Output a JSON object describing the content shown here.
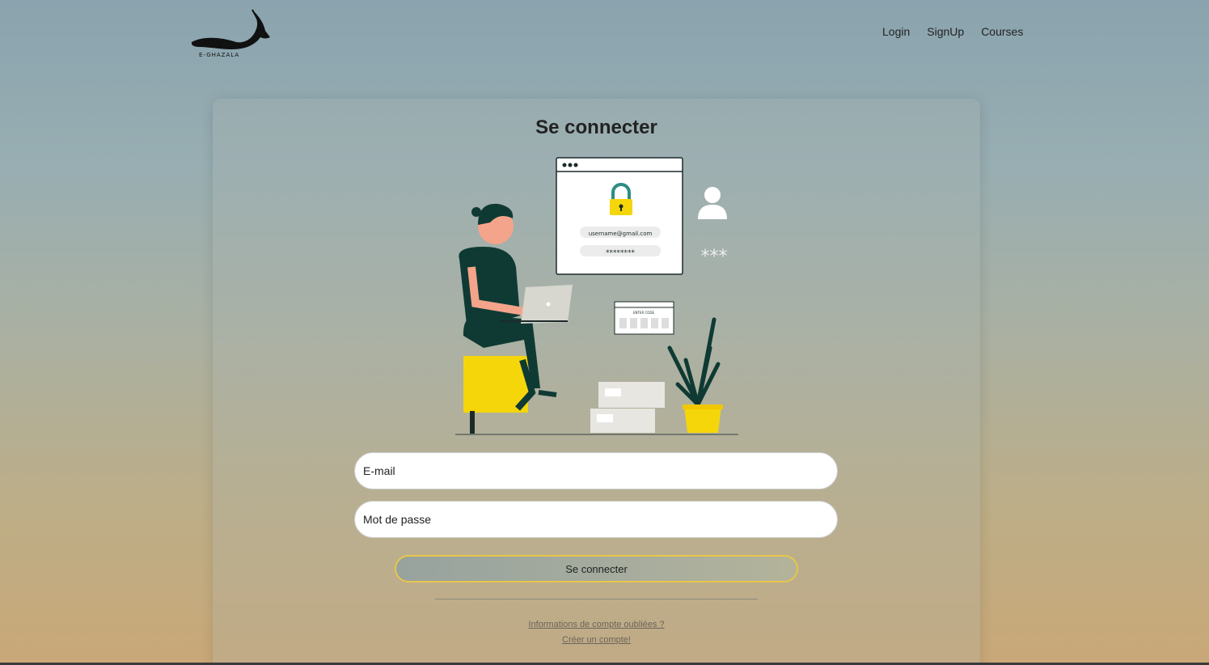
{
  "header": {
    "logo_text": "E-GHAZALA",
    "nav": [
      {
        "label": "Login"
      },
      {
        "label": "SignUp"
      },
      {
        "label": "Courses"
      }
    ]
  },
  "login": {
    "title": "Se connecter",
    "illustration": {
      "username_text": "username@gmail.com",
      "password_text": "********",
      "code_text": "ENTER CODE",
      "stars_text": "***"
    },
    "email_placeholder": "E-mail",
    "password_placeholder": "Mot de passe",
    "submit_label": "Se connecter",
    "forgot_link": "Informations de compte oubliées ?",
    "create_link": "Créer un compte!"
  },
  "colors": {
    "accent_yellow": "#f5d60a",
    "dark_green": "#0f3a34",
    "button_border": "#e8c64a"
  }
}
